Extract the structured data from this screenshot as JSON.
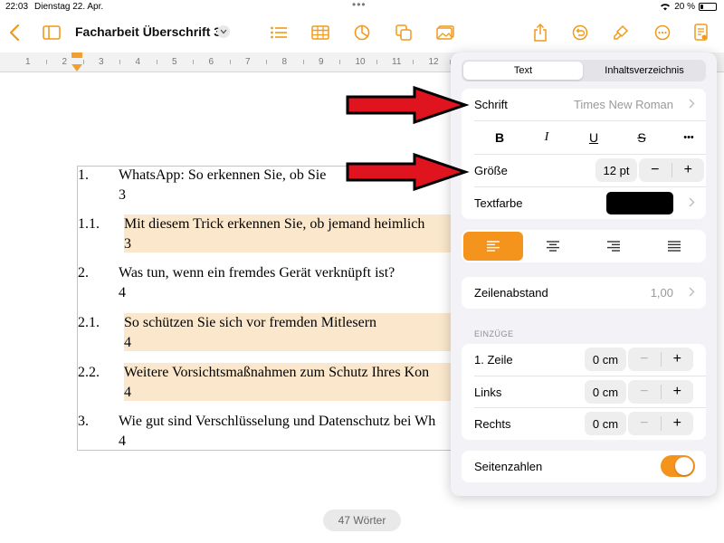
{
  "status": {
    "time": "22:03",
    "date": "Dienstag 22. Apr.",
    "battery": "20 %",
    "battery_level": 0.2
  },
  "toolbar": {
    "back_icon": "chevron-left-icon",
    "sidebar_icon": "sidebar-icon",
    "title": "Facharbeit Überschrift 3",
    "icons": [
      "list-icon",
      "table-icon",
      "chart-icon",
      "shapes-icon",
      "media-icon",
      "share-icon",
      "undo-icon",
      "format-brush-icon",
      "more-icon",
      "document-options-icon"
    ]
  },
  "ruler": {
    "ticks": [
      "1",
      "2",
      "3",
      "4",
      "5",
      "6",
      "7",
      "8",
      "9",
      "10",
      "11",
      "12"
    ]
  },
  "document": {
    "entries": [
      {
        "num": "1.",
        "text": "WhatsApp: So erkennen Sie, ob Sie",
        "page": "3",
        "highlight": false
      },
      {
        "num": "1.1.",
        "text": "Mit diesem Trick erkennen Sie, ob jemand heimlich",
        "page": "3",
        "highlight": true
      },
      {
        "num": "2.",
        "text": "Was tun, wenn ein fremdes Gerät verknüpft ist?",
        "page": "4",
        "highlight": false
      },
      {
        "num": "2.1.",
        "text": "So schützen Sie sich vor fremden Mitlesern",
        "page": "4",
        "highlight": true
      },
      {
        "num": "2.2.",
        "text": "Weitere Vorsichtsmaßnahmen zum Schutz Ihres Kon",
        "page": "4",
        "highlight": true
      },
      {
        "num": "3.",
        "text": "Wie gut sind Verschlüsselung und Datenschutz bei Wh",
        "page": "4",
        "highlight": false
      }
    ],
    "word_count": "47 Wörter"
  },
  "panel": {
    "tabs": [
      "Text",
      "Inhaltsverzeichnis"
    ],
    "active_tab": "Text",
    "font": {
      "label": "Schrift",
      "value": "Times New Roman"
    },
    "styles": {
      "bold": "B",
      "italic": "I",
      "underline": "U",
      "strike": "S",
      "more": "•••"
    },
    "size": {
      "label": "Größe",
      "value": "12 pt",
      "minus": "−",
      "plus": "+"
    },
    "color": {
      "label": "Textfarbe",
      "value": "#000000"
    },
    "alignment": {
      "options": [
        "align-left-icon",
        "align-center-icon",
        "align-right-icon",
        "align-justify-icon"
      ],
      "active": "align-left-icon"
    },
    "spacing": {
      "label": "Zeilenabstand",
      "value": "1,00"
    },
    "indents": {
      "header": "EINZÜGE",
      "rows": [
        {
          "label": "1. Zeile",
          "value": "0 cm"
        },
        {
          "label": "Links",
          "value": "0 cm"
        },
        {
          "label": "Rechts",
          "value": "0 cm"
        }
      ]
    },
    "page_numbers": {
      "label": "Seitenzahlen",
      "on": true
    }
  },
  "colors": {
    "accent": "#f5941c",
    "highlight": "#fbe8cc",
    "arrow": "#e0141e"
  }
}
